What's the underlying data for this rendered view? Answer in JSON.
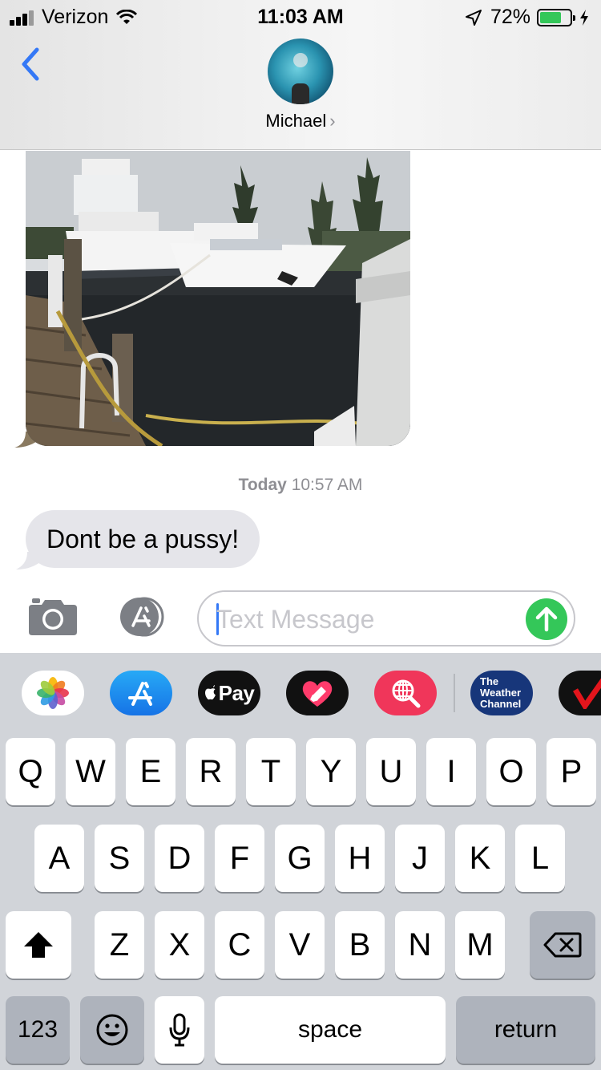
{
  "status_bar": {
    "carrier": "Verizon",
    "time": "11:03 AM",
    "battery_percent": "72%",
    "battery_level": 0.72,
    "icons": [
      "signal-icon",
      "wifi-icon",
      "location-icon",
      "battery-icon",
      "charging-icon"
    ]
  },
  "header": {
    "contact_name": "Michael",
    "back_icon": "chevron-left-icon",
    "detail_icon": "chevron-right-icon"
  },
  "messages": {
    "photo": {
      "type": "image",
      "subject": "yachts-at-dock"
    },
    "timestamp_day": "Today",
    "timestamp_time": "10:57 AM",
    "text": "Dont be a pussy!"
  },
  "compose": {
    "placeholder": "Text Message",
    "camera_icon": "camera-icon",
    "apps_icon": "app-store-icon",
    "send_icon": "arrow-up-icon"
  },
  "app_drawer": {
    "apps": [
      {
        "name": "photos",
        "icon": "photos-icon"
      },
      {
        "name": "app-store",
        "icon": "app-store-icon"
      },
      {
        "name": "apple-pay",
        "label": "Pay",
        "icon": "apple-icon"
      },
      {
        "name": "digital-touch",
        "icon": "heart-icon"
      },
      {
        "name": "images-search",
        "icon": "globe-search-icon"
      },
      {
        "name": "the-weather-channel",
        "label": "The Weather Channel"
      },
      {
        "name": "verizon",
        "icon": "check-icon"
      }
    ]
  },
  "keyboard": {
    "row1": [
      "Q",
      "W",
      "E",
      "R",
      "T",
      "Y",
      "U",
      "I",
      "O",
      "P"
    ],
    "row2": [
      "A",
      "S",
      "D",
      "F",
      "G",
      "H",
      "J",
      "K",
      "L"
    ],
    "row3": [
      "Z",
      "X",
      "C",
      "V",
      "B",
      "N",
      "M"
    ],
    "numbers_label": "123",
    "space_label": "space",
    "return_label": "return",
    "shift_icon": "shift-icon",
    "delete_icon": "delete-icon",
    "emoji_icon": "emoji-icon",
    "mic_icon": "microphone-icon"
  },
  "colors": {
    "ios_blue": "#3478f6",
    "send_green": "#34c759",
    "bubble_gray": "#e5e5ea",
    "keyboard_bg": "#d1d4d9"
  }
}
